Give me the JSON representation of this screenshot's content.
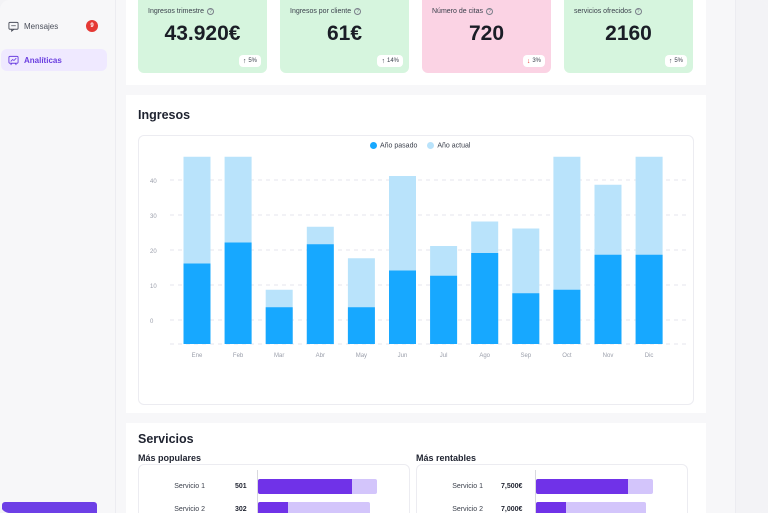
{
  "sidebar": {
    "items": [
      {
        "label": "Mensajes",
        "icon": "message-icon",
        "badge": "9",
        "active": false
      },
      {
        "label": "Analíticas",
        "icon": "analytics-icon",
        "active": true
      }
    ]
  },
  "kpis": [
    {
      "label": "Ingresos trimestre",
      "value": "43.920€",
      "trend": "5%",
      "direction": "up",
      "color": "#d6f5de"
    },
    {
      "label": "Ingresos por cliente",
      "value": "61€",
      "trend": "14%",
      "direction": "up",
      "color": "#d6f5de"
    },
    {
      "label": "Número de citas",
      "value": "720",
      "trend": "3%",
      "direction": "down",
      "color": "#fbd3e4"
    },
    {
      "label": "servicios ofrecidos",
      "value": "2160",
      "trend": "5%",
      "direction": "up",
      "color": "#d6f5de"
    }
  ],
  "ingresos": {
    "title": "Ingresos",
    "chart_data": {
      "type": "bar",
      "categories": [
        "Ene",
        "Feb",
        "Mar",
        "Abr",
        "May",
        "Jun",
        "Jul",
        "Ago",
        "Sep",
        "Oct",
        "Nov",
        "Dic"
      ],
      "series": [
        {
          "name": "Año pasado",
          "color": "#17a8ff",
          "values": [
            19,
            25,
            6.5,
            24.5,
            6.5,
            17,
            15.5,
            22,
            10.5,
            11.5,
            21.5,
            21.5
          ]
        },
        {
          "name": "Año actual",
          "color": "#b9e3fb",
          "values": [
            49.5,
            49.5,
            11.5,
            29.5,
            20.5,
            44,
            24,
            31,
            29,
            49.5,
            41.5,
            49.5
          ]
        }
      ],
      "yticks": [
        0,
        10,
        20,
        30,
        40
      ],
      "ylim": [
        -4,
        50
      ],
      "stacked": false,
      "grid": true,
      "legend": "top-center"
    }
  },
  "servicios": {
    "title": "Servicios",
    "populares": {
      "title": "Más populares",
      "rows": [
        {
          "label": "Servicio 1",
          "value": "501",
          "frac": 0.78,
          "total": 0.99
        },
        {
          "label": "Servicio 2",
          "value": "302",
          "frac": 0.25,
          "total": 0.93
        }
      ]
    },
    "rentables": {
      "title": "Más rentables",
      "rows": [
        {
          "label": "Servicio 1",
          "value": "7,500€",
          "frac": 0.78,
          "total": 0.99
        },
        {
          "label": "Servicio 2",
          "value": "7,000€",
          "frac": 0.25,
          "total": 0.93
        }
      ]
    }
  }
}
